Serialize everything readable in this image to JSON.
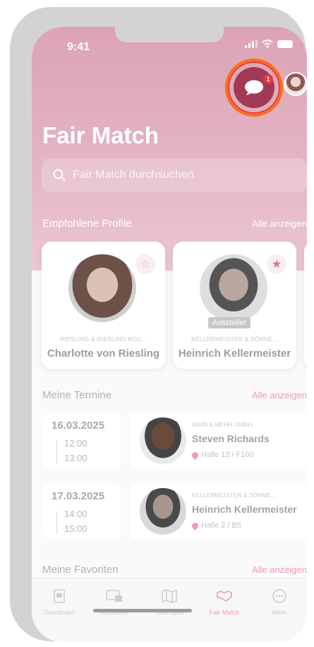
{
  "status_bar": {
    "time": "9:41"
  },
  "header": {
    "title": "Fair Match",
    "chat_badge_count": "1"
  },
  "search": {
    "placeholder": "Fair Match durchsuchen"
  },
  "recommended": {
    "title": "Empfohlene Profile",
    "link": "Alle anzeigen",
    "profiles": [
      {
        "company": "RIESLING & RIESLING BOU...",
        "name": "Charlotte von Riesling",
        "favorited": false,
        "tag": ""
      },
      {
        "company": "KELLERMEISTER & SÖHNE...",
        "name": "Heinrich Kellermeister",
        "favorited": true,
        "tag": "Aussteller"
      }
    ]
  },
  "appointments": {
    "title": "Meine Termine",
    "link": "Alle anzeigen",
    "items": [
      {
        "date": "16.03.2025",
        "start": "12:00",
        "end": "13:00",
        "company": "WEIN & MEHR GMBH",
        "name": "Steven Richards",
        "location": "Halle 13 / F100"
      },
      {
        "date": "17.03.2025",
        "start": "14:00",
        "end": "15:00",
        "company": "KELLERMEISTER & SÖHNE...",
        "name": "Heinrich Kellermeister",
        "location": "Halle 2 / B5"
      }
    ]
  },
  "favorites": {
    "title": "Meine Favoriten",
    "link": "Alle anzeigen"
  },
  "tabs": [
    {
      "label": "Dashboard",
      "icon": "dashboard-icon",
      "active": false
    },
    {
      "label": "Aussteller",
      "icon": "exhibitor-icon",
      "active": false
    },
    {
      "label": "Hallenplan",
      "icon": "map-icon",
      "active": false
    },
    {
      "label": "Fair Match",
      "icon": "handshake-icon",
      "active": true
    },
    {
      "label": "Mehr",
      "icon": "more-icon",
      "active": false
    }
  ],
  "colors": {
    "hero": "#dca3b5",
    "accent": "#ef9bb0",
    "chat_button": "#a23a55",
    "highlight_ring": "#ff6b1a"
  }
}
